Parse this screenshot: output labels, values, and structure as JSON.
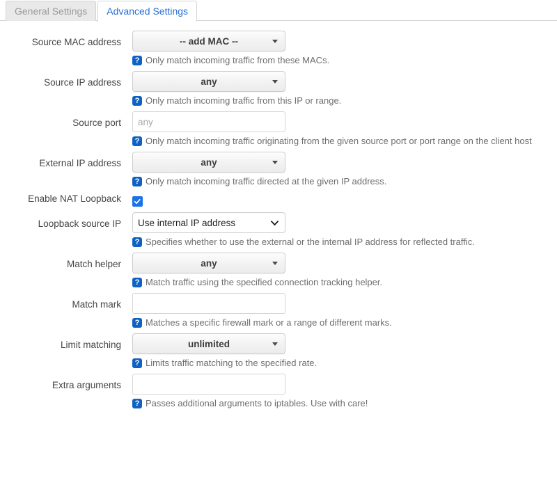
{
  "tabs": [
    {
      "label": "General Settings",
      "active": false
    },
    {
      "label": "Advanced Settings",
      "active": true
    }
  ],
  "colors": {
    "accent_blue": "#2a6fd6",
    "help_icon_blue": "#0f62c4",
    "checkbox_blue": "#1a73e8",
    "inactive_tab_bg": "#e9e9e9",
    "inactive_tab_text": "#9b9b9b",
    "border": "#d4d4d4"
  },
  "help_icon_glyph": "?",
  "form": {
    "rows": [
      {
        "label": "Source MAC address",
        "control": "dropdown",
        "value": "-- add MAC --",
        "help": "Only match incoming traffic from these MACs."
      },
      {
        "label": "Source IP address",
        "control": "dropdown",
        "value": "any",
        "help": "Only match incoming traffic from this IP or range."
      },
      {
        "label": "Source port",
        "control": "input",
        "value": "",
        "placeholder": "any",
        "help": "Only match incoming traffic originating from the given source port or port range on the client host"
      },
      {
        "label": "External IP address",
        "control": "dropdown",
        "value": "any",
        "help": "Only match incoming traffic directed at the given IP address."
      },
      {
        "label": "Enable NAT Loopback",
        "control": "checkbox",
        "checked": true,
        "help": ""
      },
      {
        "label": "Loopback source IP",
        "control": "select",
        "value": "Use internal IP address",
        "help": "Specifies whether to use the external or the internal IP address for reflected traffic."
      },
      {
        "label": "Match helper",
        "control": "dropdown",
        "value": "any",
        "help": "Match traffic using the specified connection tracking helper."
      },
      {
        "label": "Match mark",
        "control": "input",
        "value": "",
        "placeholder": "",
        "help": "Matches a specific firewall mark or a range of different marks."
      },
      {
        "label": "Limit matching",
        "control": "dropdown",
        "value": "unlimited",
        "help": "Limits traffic matching to the specified rate."
      },
      {
        "label": "Extra arguments",
        "control": "input",
        "value": "",
        "placeholder": "",
        "help": "Passes additional arguments to iptables. Use with care!"
      }
    ]
  }
}
